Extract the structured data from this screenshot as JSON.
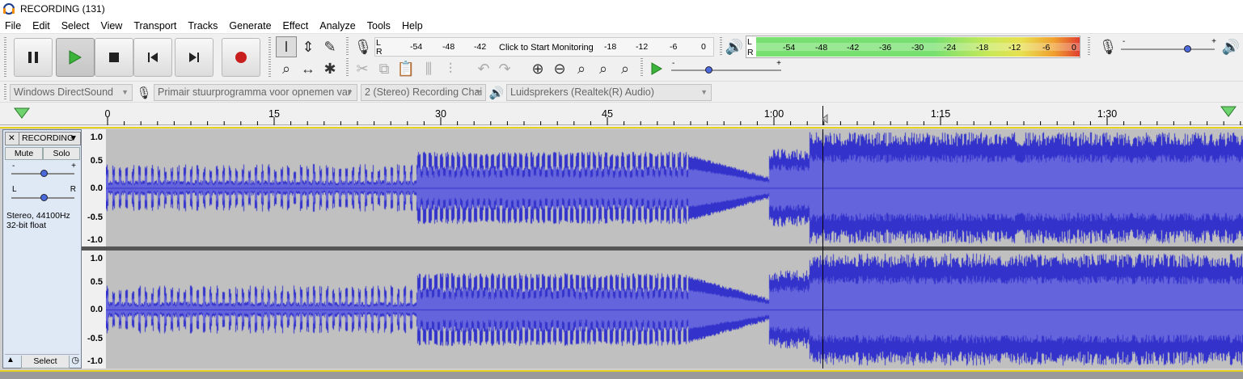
{
  "window": {
    "title": "RECORDING (131)"
  },
  "menu": [
    "File",
    "Edit",
    "Select",
    "View",
    "Transport",
    "Tracks",
    "Generate",
    "Effect",
    "Analyze",
    "Tools",
    "Help"
  ],
  "transport": {
    "pause": "pause-icon",
    "play": "play-icon",
    "stop": "stop-icon",
    "skip_start": "skip-start-icon",
    "skip_end": "skip-end-icon",
    "record": "record-icon"
  },
  "record_meter": {
    "channel_l": "L",
    "channel_r": "R",
    "ticks": [
      "-54",
      "-48",
      "-42",
      "-18",
      "-12",
      "-6",
      "0"
    ],
    "prompt": "Click to Start Monitoring"
  },
  "play_meter": {
    "channel_l": "L",
    "channel_r": "R",
    "ticks": [
      "-54",
      "-48",
      "-42",
      "-36",
      "-30",
      "-24",
      "-18",
      "-12",
      "-6",
      "0"
    ]
  },
  "slider_labels": {
    "minus": "-",
    "plus": "+"
  },
  "devices": {
    "host": "Windows DirectSound",
    "input": "Primair stuurprogramma voor opnemen var",
    "channels": "2 (Stereo) Recording Chai",
    "output": "Luidsprekers (Realtek(R) Audio)"
  },
  "timeline": {
    "labels": [
      "0",
      "15",
      "30",
      "45",
      "1:00",
      "1:15",
      "1:30"
    ]
  },
  "track": {
    "name": "RECORDING",
    "mute": "Mute",
    "solo": "Solo",
    "gain_minus": "-",
    "gain_plus": "+",
    "pan_l": "L",
    "pan_r": "R",
    "info_line1": "Stereo, 44100Hz",
    "info_line2": "32-bit float",
    "select": "Select",
    "scale": [
      "1.0",
      "0.5",
      "0.0",
      "-0.5",
      "-1.0"
    ]
  },
  "colors": {
    "wave": "#3333cc",
    "wave_rms": "#6464dc",
    "track_bg": "#c0c0c0",
    "meter_green": "#78e070",
    "meter_yellow": "#e8e050",
    "meter_red": "#e04030"
  }
}
